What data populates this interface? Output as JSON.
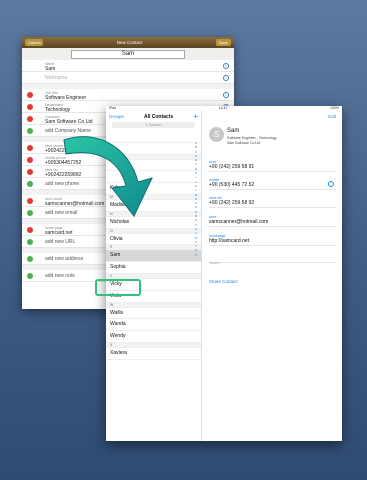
{
  "back_form": {
    "cancel_label": "Cancel",
    "title": "New Contact",
    "save_label": "Save",
    "name_display": "Sam",
    "rows": [
      {
        "label": "Name",
        "value": "Sam",
        "kind": "field",
        "marker": "none",
        "info": true
      },
      {
        "label": "",
        "value": "Nickname",
        "kind": "placeholder",
        "marker": "none",
        "info": true
      },
      {
        "kind": "section"
      },
      {
        "label": "Job Title",
        "value": "Software Engineer",
        "kind": "field",
        "marker": "red",
        "info": true
      },
      {
        "label": "Department",
        "value": "Technology",
        "kind": "field",
        "marker": "red",
        "info": true
      },
      {
        "label": "Company",
        "value": "Sam Software Co.Ltd",
        "kind": "field",
        "marker": "red",
        "info": true
      },
      {
        "label": "",
        "value": "add Company Name",
        "kind": "action",
        "marker": "green",
        "info": false
      },
      {
        "kind": "section"
      },
      {
        "label": "work phone",
        "value": "+902422259891",
        "kind": "field",
        "marker": "red",
        "info": false
      },
      {
        "label": "mobile phone",
        "value": "+905304457252",
        "kind": "field",
        "marker": "red",
        "info": false
      },
      {
        "label": "work fax",
        "value": "+902422259892",
        "kind": "field",
        "marker": "red",
        "info": false
      },
      {
        "label": "",
        "value": "add new phone",
        "kind": "action",
        "marker": "green",
        "info": false
      },
      {
        "kind": "section"
      },
      {
        "label": "work email",
        "value": "samscanner@hotmail.com",
        "kind": "field",
        "marker": "red",
        "info": false
      },
      {
        "label": "",
        "value": "add new email",
        "kind": "action",
        "marker": "green",
        "info": false
      },
      {
        "kind": "section"
      },
      {
        "label": "home page",
        "value": "samcard.net",
        "kind": "field",
        "marker": "red",
        "info": false
      },
      {
        "label": "",
        "value": "add new URL",
        "kind": "action",
        "marker": "green",
        "info": false
      },
      {
        "kind": "section"
      },
      {
        "label": "",
        "value": "add new address",
        "kind": "action",
        "marker": "green",
        "info": false
      },
      {
        "kind": "section"
      },
      {
        "label": "",
        "value": "add new note",
        "kind": "action",
        "marker": "green",
        "info": false
      }
    ]
  },
  "front": {
    "status_left": "iPad",
    "status_time": "14:42",
    "status_right": "100%",
    "groups_label": "Groups",
    "list_title": "All Contacts",
    "add_symbol": "+",
    "search_placeholder": "Search",
    "contacts": [
      {
        "text": "",
        "kind": "row"
      },
      {
        "text": "",
        "kind": "row"
      },
      {
        "text": "",
        "kind": "section"
      },
      {
        "text": "",
        "kind": "row"
      },
      {
        "text": "",
        "kind": "row"
      },
      {
        "text": "Kirby",
        "kind": "row"
      },
      {
        "text": "M",
        "kind": "section"
      },
      {
        "text": "Madison",
        "kind": "row"
      },
      {
        "text": "N",
        "kind": "section"
      },
      {
        "text": "Nicholas",
        "kind": "row"
      },
      {
        "text": "O",
        "kind": "section"
      },
      {
        "text": "Olivia",
        "kind": "row"
      },
      {
        "text": "S",
        "kind": "section"
      },
      {
        "text": "Sam",
        "kind": "selected"
      },
      {
        "text": "Sophia",
        "kind": "row"
      },
      {
        "text": "V",
        "kind": "section"
      },
      {
        "text": "Vicky",
        "kind": "row"
      },
      {
        "text": "Viola",
        "kind": "row"
      },
      {
        "text": "W",
        "kind": "section"
      },
      {
        "text": "Wallis",
        "kind": "row"
      },
      {
        "text": "Wanda",
        "kind": "row"
      },
      {
        "text": "Wendy",
        "kind": "row"
      },
      {
        "text": "X",
        "kind": "section"
      },
      {
        "text": "Xaviera",
        "kind": "row"
      }
    ],
    "index_letters": [
      "A",
      "B",
      "C",
      "D",
      "E",
      "F",
      "G",
      "H",
      "I",
      "J",
      "K",
      "L",
      "M",
      "N",
      "O",
      "P",
      "Q",
      "R",
      "S",
      "T",
      "U",
      "V",
      "W",
      "X",
      "Y",
      "Z",
      "#"
    ],
    "detail": {
      "edit_label": "Edit",
      "avatar_letter": "S",
      "name": "Sam",
      "subtitle_1": "Software Engineer - Technology",
      "subtitle_2": "Sam Software Co.Ltd",
      "fields": [
        {
          "label": "work",
          "value": "+90 (242) 259 58 91",
          "icon": false
        },
        {
          "label": "mobile",
          "value": "+90 (530) 445 72 52",
          "icon": true
        },
        {
          "label": "work fax",
          "value": "+90 (242) 259 58 92",
          "icon": false
        },
        {
          "label": "work",
          "value": "samscanner@hotmail.com",
          "icon": false
        },
        {
          "label": "homepage",
          "value": "http://samcard.net",
          "icon": false
        },
        {
          "label": "",
          "value": "Notes",
          "icon": false
        }
      ],
      "share_label": "Share Contact"
    }
  },
  "colors": {
    "background_top": "#5d7aa0",
    "background_bottom": "#2f4b73",
    "accent_blue": "#1e88e5",
    "highlight_green": "#2ec27e",
    "arrow_teal": "#19a88f",
    "delete_red": "#e53935",
    "add_green": "#4caf50"
  }
}
